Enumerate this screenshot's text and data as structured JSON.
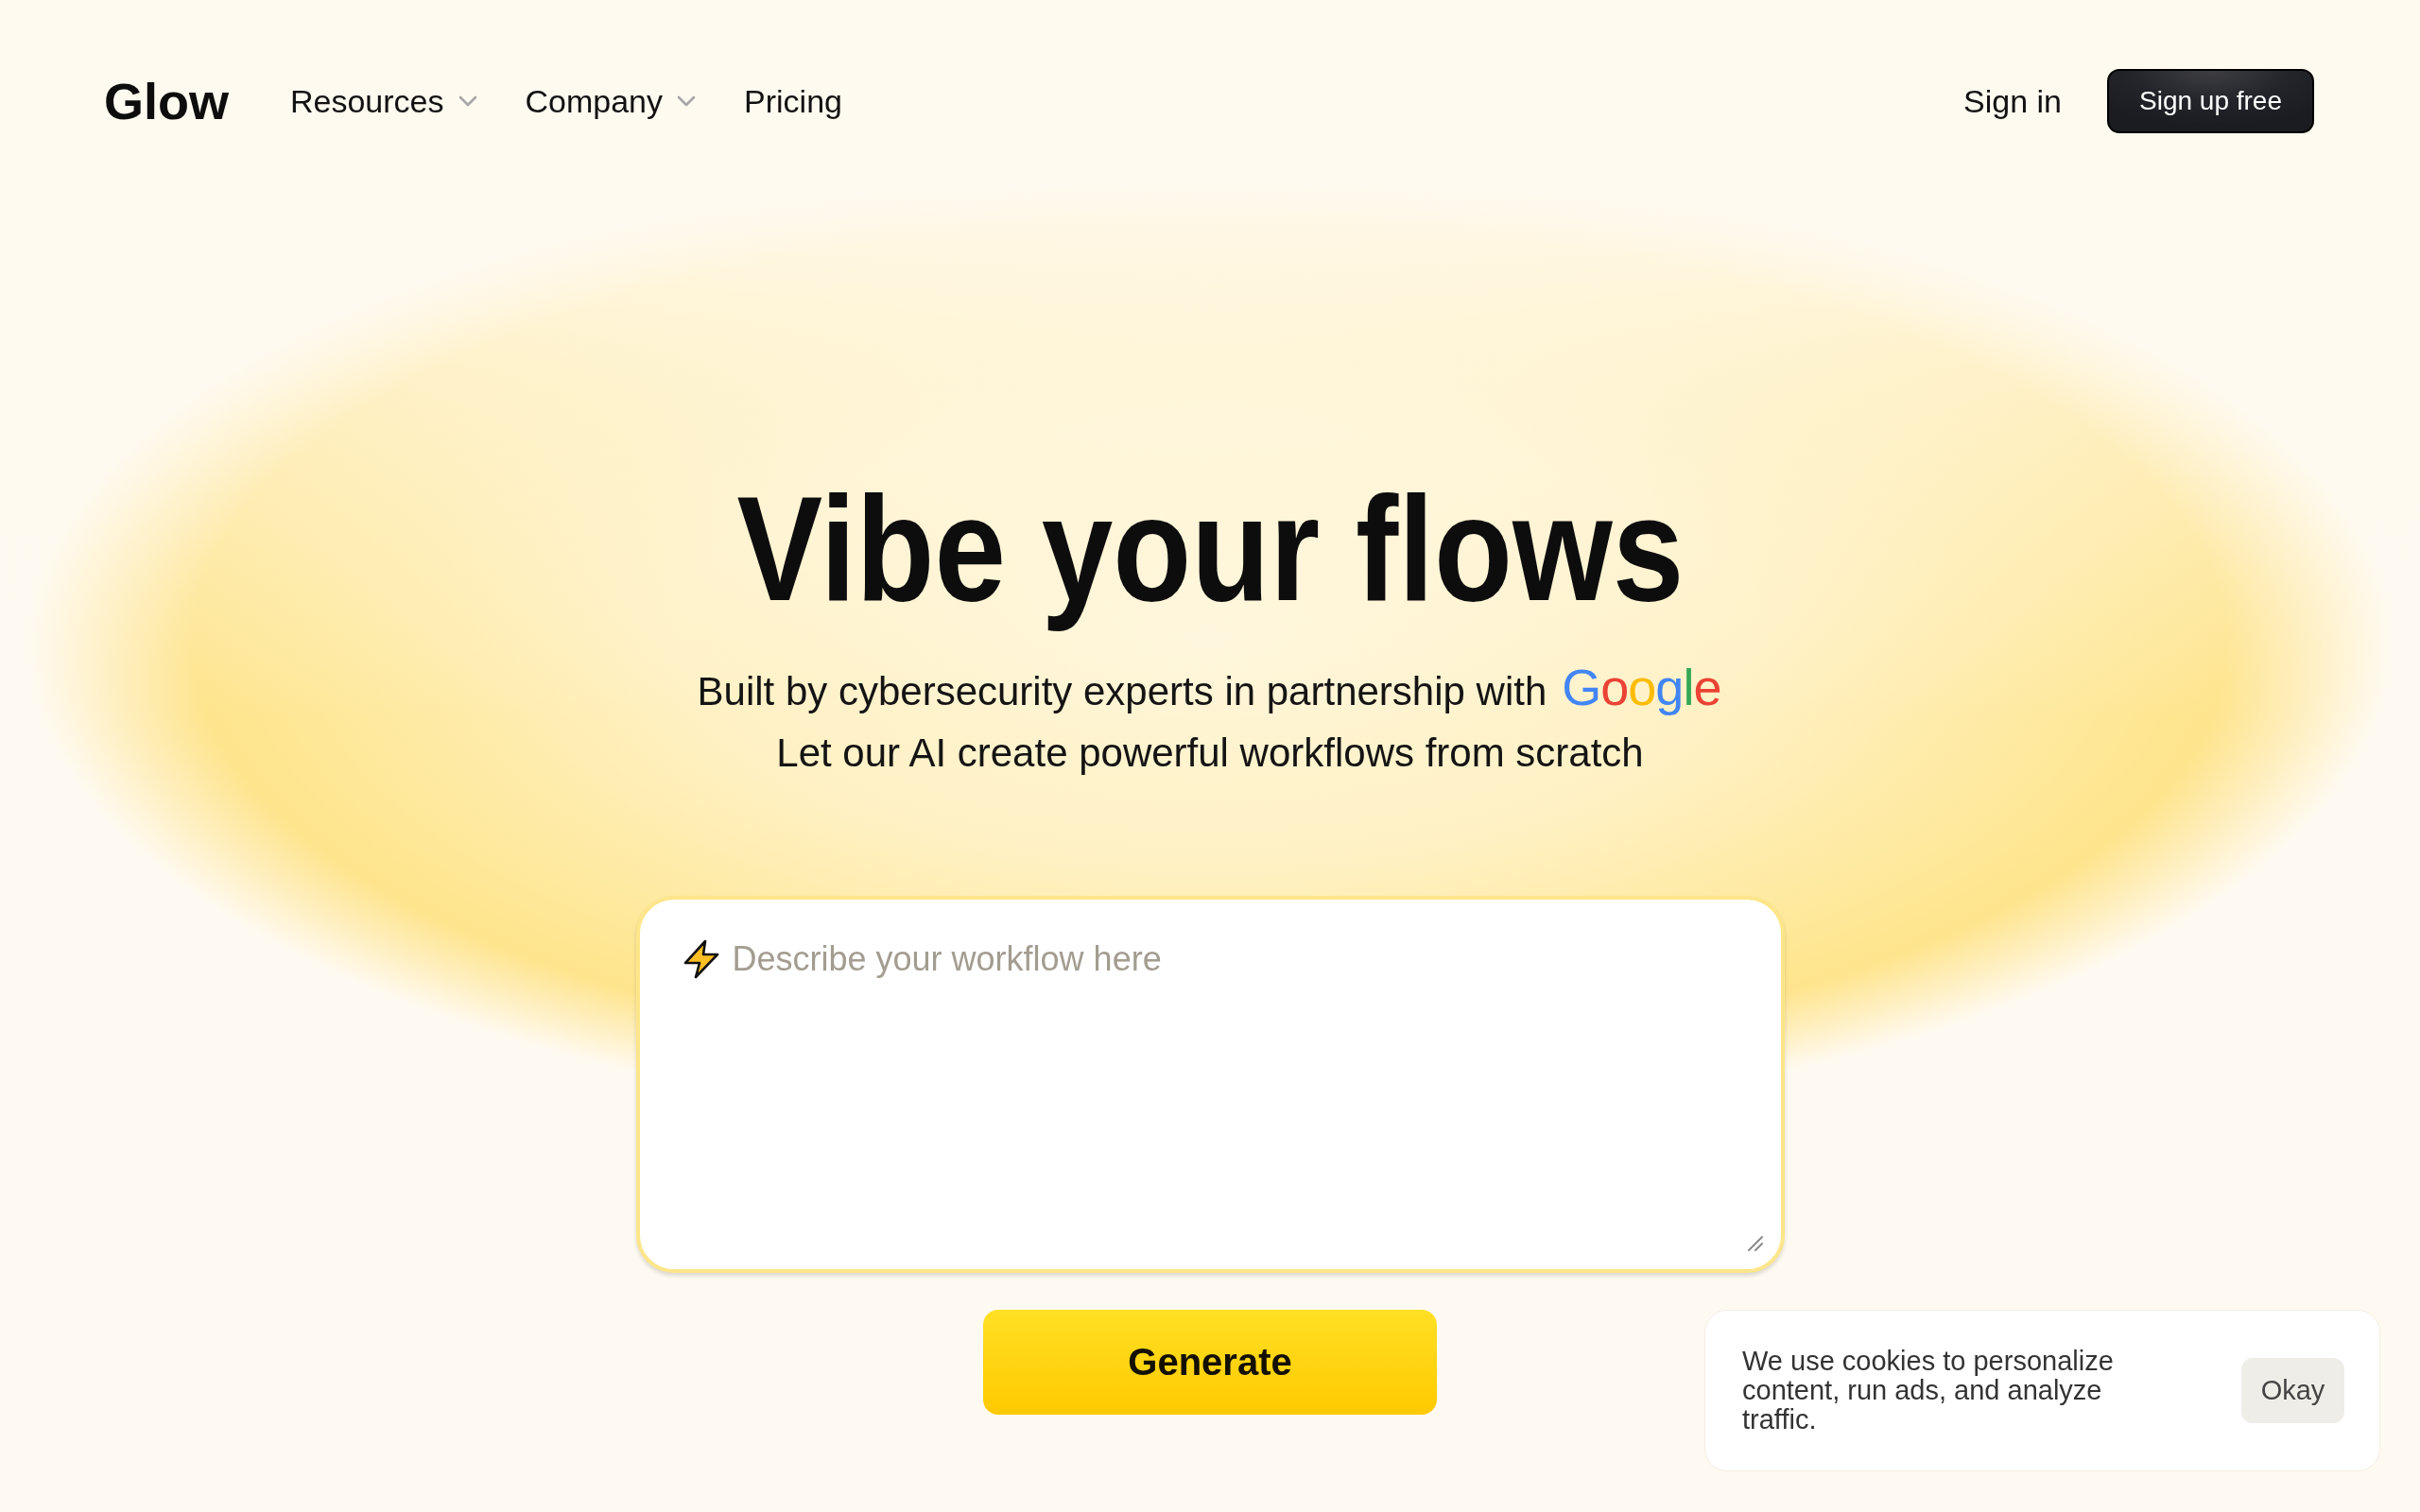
{
  "nav": {
    "logo": "Glow",
    "items": [
      {
        "label": "Resources",
        "kind": "dropdown"
      },
      {
        "label": "Company",
        "kind": "dropdown"
      },
      {
        "label": "Pricing",
        "kind": "link"
      }
    ],
    "sign_in": "Sign in",
    "sign_up": "Sign up free"
  },
  "hero": {
    "title": "Vibe your flows",
    "subtitle": "Built by cybersecurity experts in partnership with",
    "partner_logo": "Google",
    "tagline": "Let our AI create powerful workflows from scratch"
  },
  "prompt": {
    "placeholder": "Describe your workflow here",
    "button": "Generate"
  },
  "cookie_banner": {
    "text": "We use cookies to personalize content, run ads, and analyze traffic.",
    "button": "Okay"
  }
}
